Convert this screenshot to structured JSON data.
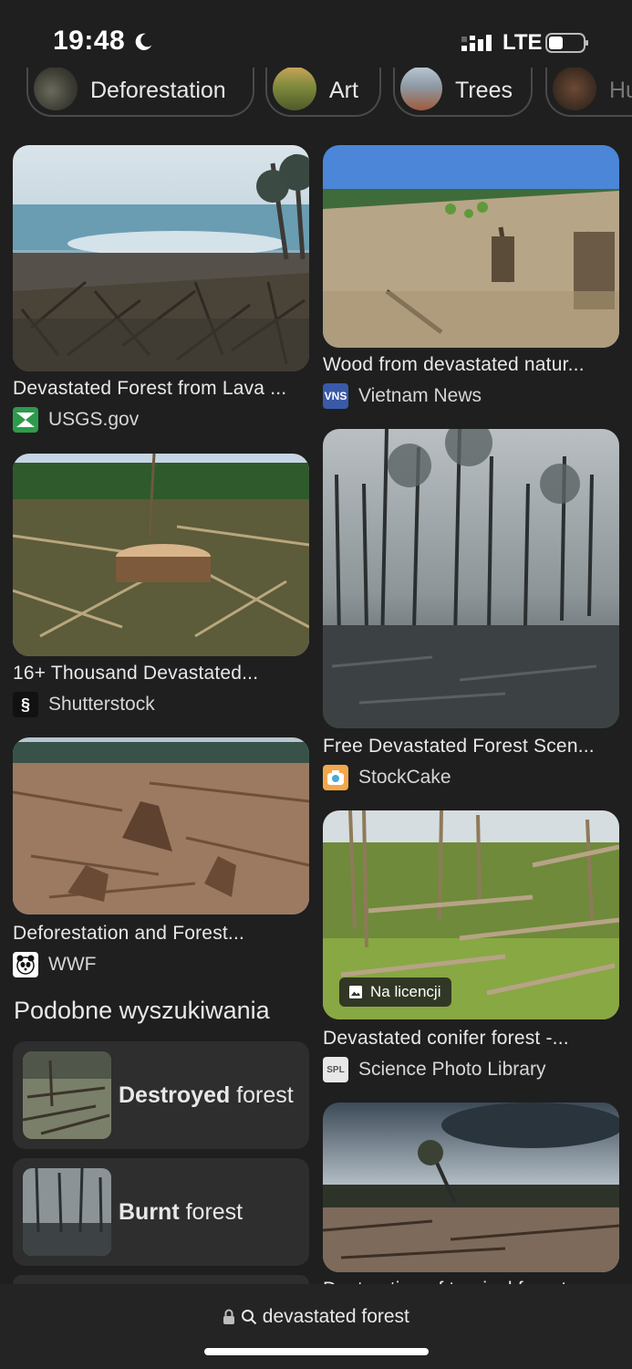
{
  "status": {
    "time": "19:48",
    "network": "LTE",
    "moon_icon": "moon-icon",
    "signal_icon": "signal-icon",
    "battery_icon": "battery-icon"
  },
  "chips": [
    {
      "label": "Deforestation"
    },
    {
      "label": "Art"
    },
    {
      "label": "Trees"
    },
    {
      "label": "Hu"
    }
  ],
  "results": [
    {
      "title": "Devastated Forest from Lava ...",
      "source": "USGS.gov"
    },
    {
      "title": "Wood from devastated natur...",
      "source": "Vietnam News"
    },
    {
      "title": "16+ Thousand Devastated...",
      "source": "Shutterstock"
    },
    {
      "title": "Free Devastated Forest Scen...",
      "source": "StockCake"
    },
    {
      "title": "Deforestation and Forest...",
      "source": "WWF"
    },
    {
      "title": "Devastated conifer forest -...",
      "source": "Science Photo Library",
      "badge": "Na licencji"
    },
    {
      "title": "Destruction of tropical forest",
      "source": ""
    }
  ],
  "favicons": {
    "usgs": "USGS",
    "vn": "VNS",
    "spl": "SPL"
  },
  "related": {
    "heading": "Podobne wyszukiwania",
    "items": [
      {
        "bold": "Destroyed",
        "rest": " forest"
      },
      {
        "bold": "Burnt",
        "rest": " forest"
      }
    ]
  },
  "bottom": {
    "url": "devastated forest"
  },
  "colors": {
    "background": "#1f1f1f",
    "card": "#2e2e2e",
    "text": "#e3e3e3"
  }
}
